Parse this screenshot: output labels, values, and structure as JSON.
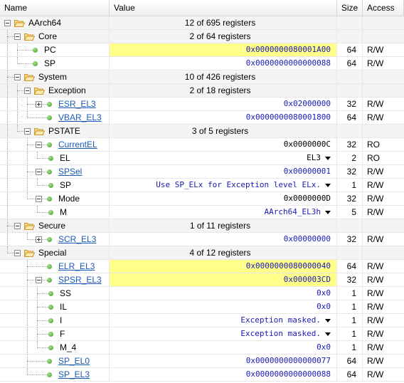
{
  "header": {
    "name": "Name",
    "value": "Value",
    "size": "Size",
    "access": "Access"
  },
  "rows": [
    {
      "kind": "group",
      "level": 0,
      "name": "AArch64",
      "value": "12 of 695 registers"
    },
    {
      "kind": "group",
      "level": 1,
      "name": "Core",
      "value": "2 of 64 registers"
    },
    {
      "kind": "reg",
      "level": 2,
      "name": "PC",
      "value": "0x0000000080001A00",
      "size": "64",
      "access": "R/W",
      "highlight": true
    },
    {
      "kind": "reg",
      "level": 2,
      "name": "SP",
      "value": "0x0000000000000088",
      "size": "64",
      "access": "R/W"
    },
    {
      "kind": "group",
      "level": 1,
      "name": "System",
      "value": "10 of 426 registers"
    },
    {
      "kind": "group",
      "level": 2,
      "name": "Exception",
      "value": "2 of 18 registers"
    },
    {
      "kind": "reg",
      "level": 3,
      "name": "ESR_EL3",
      "link": true,
      "expander": "plus",
      "value": "0x02000000",
      "size": "32",
      "access": "R/W"
    },
    {
      "kind": "reg",
      "level": 3,
      "name": "VBAR_EL3",
      "link": true,
      "value": "0x0000000080001800",
      "size": "64",
      "access": "R/W"
    },
    {
      "kind": "group",
      "level": 2,
      "name": "PSTATE",
      "value": "3 of 5 registers"
    },
    {
      "kind": "reg",
      "level": 3,
      "name": "CurrentEL",
      "link": true,
      "expander": "minus",
      "value": "0x0000000C",
      "valueBlack": true,
      "size": "32",
      "access": "RO"
    },
    {
      "kind": "reg",
      "level": 4,
      "name": "EL",
      "value": "EL3",
      "valueBlack": true,
      "dropdown": true,
      "size": "2",
      "access": "RO"
    },
    {
      "kind": "reg",
      "level": 3,
      "name": "SPSel",
      "link": true,
      "expander": "minus",
      "value": "0x00000001",
      "size": "32",
      "access": "R/W"
    },
    {
      "kind": "reg",
      "level": 4,
      "name": "SP",
      "value": "Use SP_ELx for Exception level ELx.",
      "dropdown": true,
      "size": "1",
      "access": "R/W"
    },
    {
      "kind": "reg",
      "level": 3,
      "name": "Mode",
      "expander": "minus",
      "value": "0x0000000D",
      "valueBlack": true,
      "size": "32",
      "access": "R/W"
    },
    {
      "kind": "reg",
      "level": 4,
      "name": "M",
      "value": "AArch64_EL3h",
      "dropdown": true,
      "size": "5",
      "access": "R/W"
    },
    {
      "kind": "group",
      "level": 1,
      "name": "Secure",
      "value": "1 of 11 registers"
    },
    {
      "kind": "reg",
      "level": 3,
      "name": "SCR_EL3",
      "link": true,
      "expander": "plus",
      "value": "0x00000000",
      "size": "32",
      "access": "R/W"
    },
    {
      "kind": "group",
      "level": 1,
      "name": "Special",
      "value": "4 of 12 registers"
    },
    {
      "kind": "reg",
      "level": 3,
      "name": "ELR_EL3",
      "link": true,
      "value": "0x0000000080000040",
      "size": "64",
      "access": "R/W",
      "highlight": true
    },
    {
      "kind": "reg",
      "level": 3,
      "name": "SPSR_EL3",
      "link": true,
      "expander": "minus",
      "value": "0x000003CD",
      "size": "32",
      "access": "R/W",
      "highlight": true
    },
    {
      "kind": "reg",
      "level": 4,
      "name": "SS",
      "value": "0x0",
      "size": "1",
      "access": "R/W"
    },
    {
      "kind": "reg",
      "level": 4,
      "name": "IL",
      "value": "0x0",
      "size": "1",
      "access": "R/W"
    },
    {
      "kind": "reg",
      "level": 4,
      "name": "I",
      "value": "Exception masked.",
      "dropdown": true,
      "size": "1",
      "access": "R/W"
    },
    {
      "kind": "reg",
      "level": 4,
      "name": "F",
      "value": "Exception masked.",
      "dropdown": true,
      "size": "1",
      "access": "R/W"
    },
    {
      "kind": "reg",
      "level": 4,
      "name": "M_4",
      "value": "0x0",
      "size": "1",
      "access": "R/W"
    },
    {
      "kind": "reg",
      "level": 3,
      "name": "SP_EL0",
      "link": true,
      "value": "0x0000000000000077",
      "size": "64",
      "access": "R/W"
    },
    {
      "kind": "reg",
      "level": 3,
      "name": "SP_EL3",
      "link": true,
      "value": "0x0000000000000088",
      "size": "64",
      "access": "R/W"
    }
  ]
}
